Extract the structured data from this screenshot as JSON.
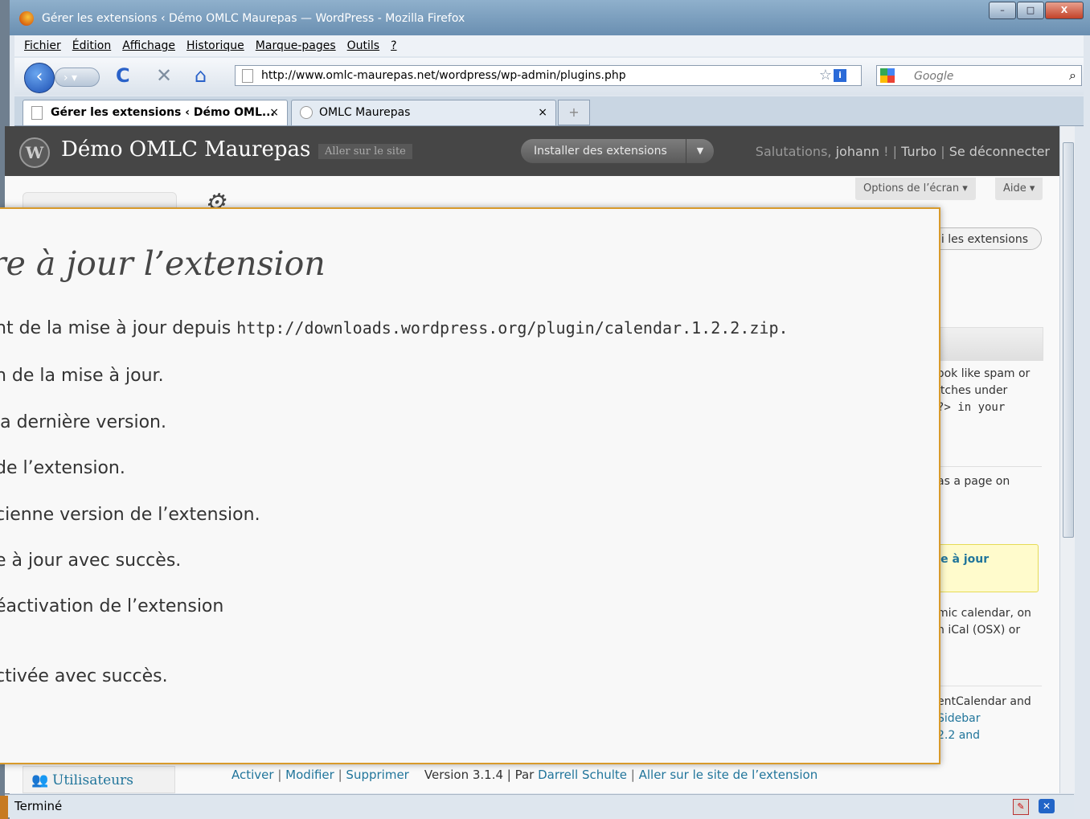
{
  "window": {
    "title": "Gérer les extensions ‹ Démo OMLC Maurepas — WordPress - Mozilla Firefox",
    "minimize": "–",
    "maximize": "□",
    "close": "X"
  },
  "menu": [
    "Fichier",
    "Édition",
    "Affichage",
    "Historique",
    "Marque-pages",
    "Outils",
    "?"
  ],
  "nav": {
    "url": "http://www.omlc-maurepas.net/wordpress/wp-admin/plugins.php",
    "search_placeholder": "Google"
  },
  "tabs": [
    {
      "label": "Gérer les extensions ‹ Démo OML...",
      "close": "×"
    },
    {
      "label": "OMLC Maurepas",
      "close": "×"
    }
  ],
  "wp": {
    "site_name": "Démo OMLC Maurepas",
    "visit_site": "Aller sur le site",
    "favorite_action": "Installer des extensions",
    "greeting": "Salutations,",
    "username": "johann",
    "turbo": "Turbo",
    "logout": "Se déconnecter",
    "screen_options": "Options de l’écran",
    "help": "Aide",
    "search_button_partial": "ni les extensions",
    "users_menu": "Utilisateurs",
    "row_texts": [
      [
        "ook like spam or",
        "itches under",
        "?>  in your"
      ],
      [
        "as a page on"
      ],
      [
        "mic calendar, on",
        "n iCal (OSX) or"
      ],
      [
        "entCalendar and",
        "Sidebar",
        "2.2 and"
      ]
    ],
    "notice_partial": "ise à jour",
    "plugin_actions": {
      "activate": "Activer",
      "edit": "Modifier",
      "delete": "Supprimer"
    },
    "plugin_version": "Version 3.1.4 | Par",
    "plugin_author": "Darrell Schulte",
    "plugin_site": "Aller sur le site de l’extension"
  },
  "overlay": {
    "title": "re à jour l’extension",
    "lines": [
      {
        "text": "nt de la mise à jour depuis ",
        "code": "http://downloads.wordpress.org/plugin/calendar.1.2.2.zip."
      },
      {
        "text": "n de la mise à jour."
      },
      {
        "text": " la dernière version."
      },
      {
        "text": "de l’extension."
      },
      {
        "text": "cienne version de l’extension."
      },
      {
        "text": "e à jour avec succès."
      },
      {
        "text": "éactivation de l’extension"
      },
      {
        "text": "ctivée avec succès."
      }
    ]
  },
  "status": {
    "text": "Terminé"
  }
}
